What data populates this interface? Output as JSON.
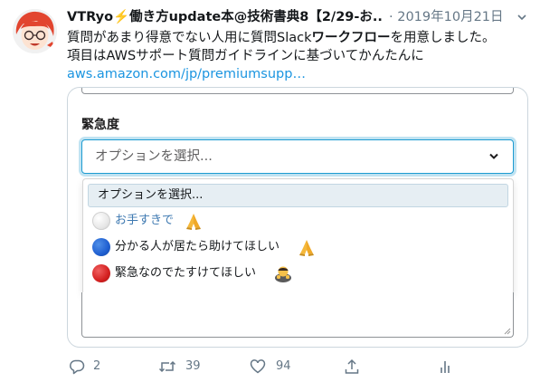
{
  "tweet": {
    "display_name": "VTRyo⚡️働き方update本@技術書典8【2/29-お...",
    "date": "· 2019年10月21日",
    "text_line1_pre": "質問があまり得意でない人用に質問Slack",
    "text_line1_bold": "ワークフロー",
    "text_line1_post": "を用意しました。",
    "text_line2": "項目はAWSサポート質問ガイドラインに基づいてかんたんに",
    "link": "aws.amazon.com/jp/premiumsupp…"
  },
  "form": {
    "label": "緊急度",
    "placeholder": "オプションを選択...",
    "options": [
      {
        "label": "オプションを選択...",
        "selected": true
      },
      {
        "label": "お手すきで",
        "circle": "white",
        "emoji": "folded-hands-icon"
      },
      {
        "label": "分かる人が居たら助けてほしい",
        "circle": "blue",
        "emoji": "folded-hands-icon"
      },
      {
        "label": "緊急なのでたすけてほしい",
        "circle": "red",
        "emoji": "bowing-person-icon"
      }
    ]
  },
  "actions": {
    "reply_count": "2",
    "retweet_count": "39",
    "like_count": "94"
  },
  "colors": {
    "link": "#1b95e0",
    "focus": "#1d9bd1",
    "muted": "#657786",
    "option_link": "#3e79b1"
  }
}
